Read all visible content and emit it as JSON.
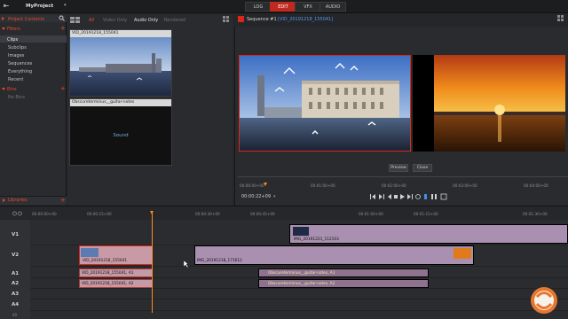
{
  "app": {
    "project_name": "MyProject",
    "project_dropdown": "▾",
    "back_glyph": "⇤"
  },
  "modes": [
    "LOG",
    "EDIT",
    "VFX",
    "AUDIO"
  ],
  "active_mode": "EDIT",
  "project_panel": {
    "header": "Project Contents",
    "filters_label": "Filters",
    "filter_items": [
      "Clips",
      "Subclips",
      "Images",
      "Sequences",
      "Everything",
      "Recent"
    ],
    "bins_label": "Bins",
    "no_bins": "No Bins",
    "libraries_label": "Libraries"
  },
  "bin_filters": [
    "All",
    "Video Only",
    "Audio Only",
    "Rendered"
  ],
  "bin_clips": [
    {
      "title": "VID_20191218_155041",
      "kind": "video"
    },
    {
      "title": "Obscureterminus__guitar-notes",
      "kind": "audio",
      "body": "Sound"
    }
  ],
  "viewer": {
    "sequence_label": "Sequence #1",
    "sequence_clip": "[VID_20191218_155041]",
    "preview_button": "Preview",
    "close_button": "Close",
    "current_time": "00:00:22+09",
    "ruler": [
      "00:00:00+00",
      "00:01:00+00",
      "00:02:00+00",
      "00:03:00+00",
      "00:04:00+00"
    ],
    "handle": "····",
    "time_menu_glyph": "▾"
  },
  "transport_icons": [
    "mark-in-icon",
    "mark-out-icon",
    "play-reverse-icon",
    "stop-icon",
    "play-icon",
    "step-icon",
    "loop-icon"
  ],
  "timeline": {
    "ruler": [
      "00:00:00+00",
      "00:00:15+00",
      "00:00:30+00",
      "00:00:45+00",
      "00:01:00+00",
      "00:01:15+00",
      "00:01:30+00"
    ],
    "tracks": [
      "V1",
      "V2",
      "A1",
      "A2",
      "A3",
      "A4"
    ],
    "clips": {
      "v1": "IMG_20191221_112103",
      "v2a": "VID_20191218_155041",
      "v2b": "IMG_20191218_171612",
      "a1a": "VID_20191218_155041, A1",
      "a2a": "VID_20191218_155041, A2",
      "a1b": "Obscureterminus__guitar-notes, A1",
      "a2b": "Obscureterminus__guitar-notes, A2"
    },
    "zoom_label": "49"
  },
  "colors": {
    "accent": "#c1281f",
    "video_clip": "#a98fb0",
    "audio_clip": "#8f7290",
    "selected_clip": "#c99aa6"
  }
}
